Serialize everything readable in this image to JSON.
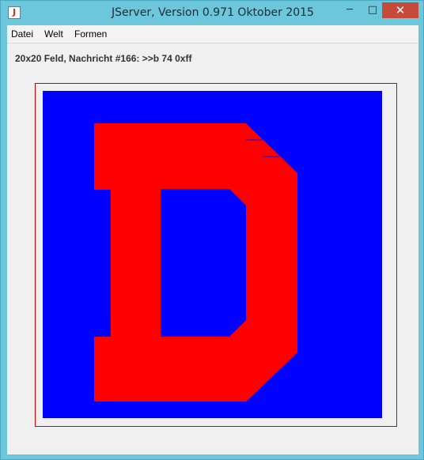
{
  "window": {
    "title": "JServer, Version 0.971 Oktober 2015",
    "app_icon_glyph": "J",
    "controls": {
      "minimize": "─",
      "maximize": "□",
      "close": "✕"
    }
  },
  "menu": {
    "items": [
      {
        "label": "Datei"
      },
      {
        "label": "Welt"
      },
      {
        "label": "Formen"
      }
    ]
  },
  "status": "20x20 Feld, Nachricht #166: >>b 74 0xff",
  "board": {
    "grid": "20x20",
    "background_color": "#0000ff",
    "shape_color": "#ff0000",
    "border_color": "#d40000",
    "shape": "letter D"
  }
}
